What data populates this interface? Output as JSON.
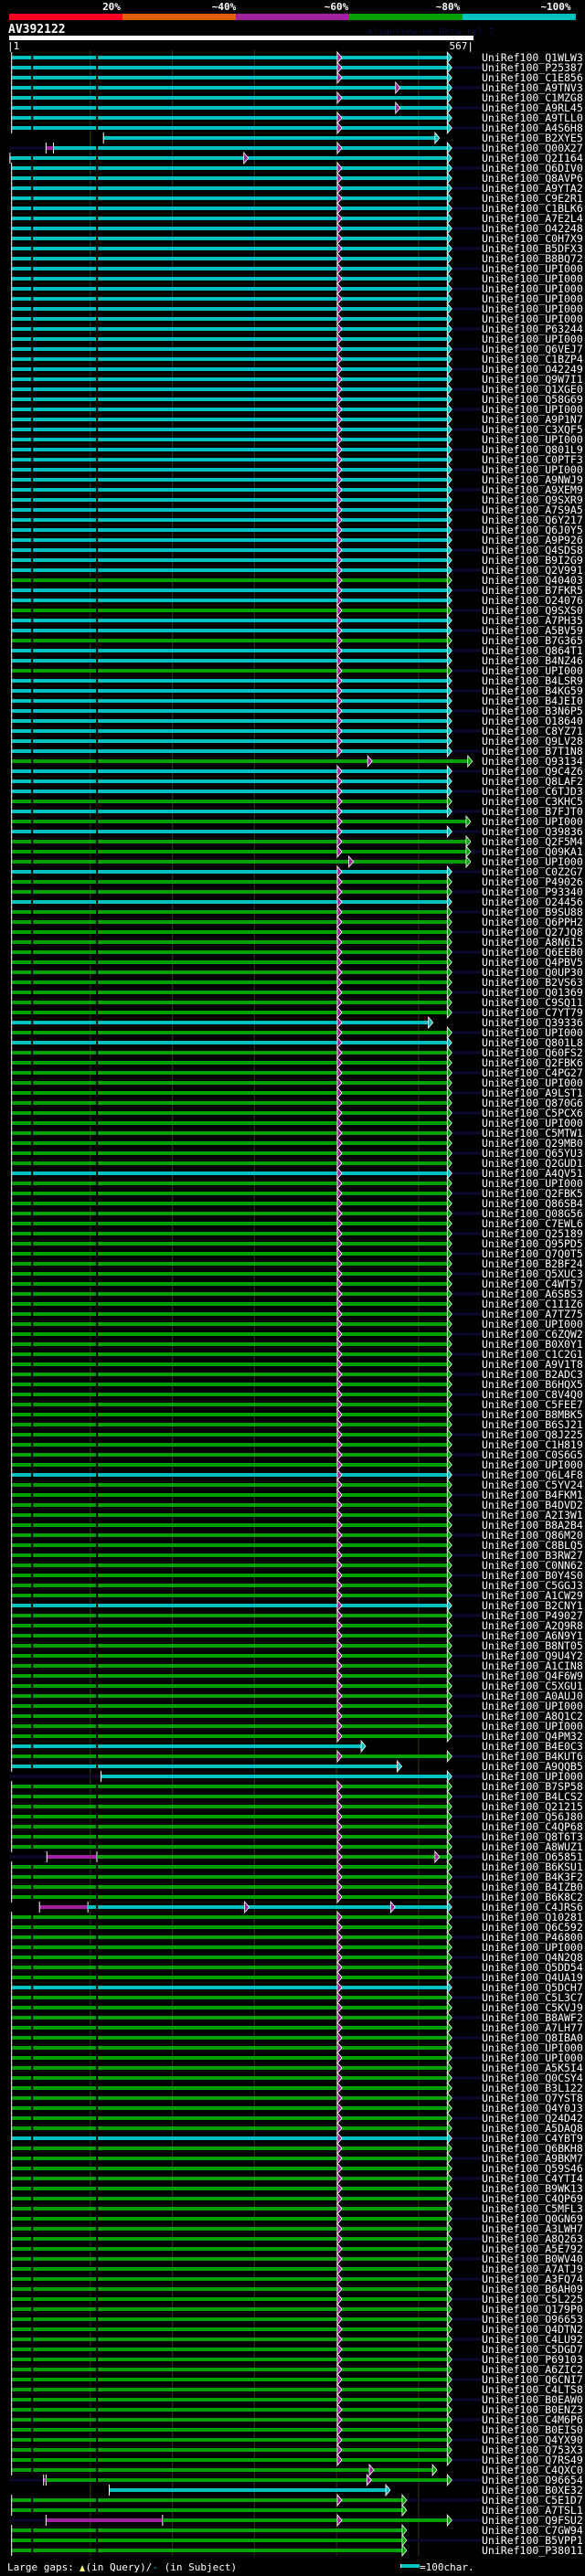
{
  "header": {
    "scale_labels": [
      "20%",
      "~40%",
      "~60%",
      "~80%",
      "~100%"
    ],
    "scale_colors": [
      "#ff0022",
      "#e06000",
      "#a020a0",
      "#00a000",
      "#00c0c0"
    ],
    "query_id": "AV392122",
    "watermark": "AlignView.pm Beta rel.7",
    "ruler_start": "|1",
    "ruler_end": "567|"
  },
  "query_length": 567,
  "colors": {
    "c": "#00c0c0",
    "g": "#00a000",
    "m": "#a020a0",
    "subject": "#0a0a30",
    "grid": "#3a3a10",
    "gap": "#ffff80"
  },
  "hits": {
    "defaults": {
      "start": 4,
      "end": 535,
      "marker": 401
    },
    "identity_runs": [
      [
        "c",
        52
      ],
      [
        "g",
        1
      ],
      [
        "c",
        2
      ],
      [
        "g",
        1
      ],
      [
        "c",
        2
      ],
      [
        "g",
        1
      ],
      [
        "c",
        2
      ],
      [
        "g",
        1
      ],
      [
        "c",
        8
      ],
      [
        "g",
        1
      ],
      [
        "c",
        3
      ],
      [
        "g",
        1
      ],
      [
        "c",
        1
      ],
      [
        "g",
        1
      ],
      [
        "c",
        1
      ],
      [
        "g",
        3
      ],
      [
        "c",
        1
      ],
      [
        "g",
        2
      ],
      [
        "c",
        1
      ],
      [
        "g",
        11
      ],
      [
        "c",
        1
      ],
      [
        "g",
        1
      ],
      [
        "c",
        1
      ],
      [
        "g",
        12
      ],
      [
        "c",
        1
      ],
      [
        "g",
        29
      ],
      [
        "c",
        1
      ],
      [
        "g",
        12
      ],
      [
        "c",
        1
      ],
      [
        "g",
        13
      ],
      [
        "c",
        1
      ],
      [
        "g",
        1
      ],
      [
        "c",
        2
      ],
      [
        "g",
        12
      ],
      [
        "c",
        1
      ],
      [
        "g",
        7
      ],
      [
        "c",
        1
      ],
      [
        "g",
        14
      ],
      [
        "c",
        1
      ],
      [
        "g",
        34
      ],
      [
        "c",
        1
      ],
      [
        "g",
        6
      ]
    ],
    "overrides": {
      "4": {
        "mk": 472
      },
      "6": {
        "mk": 472
      },
      "9": {
        "s": 116,
        "e": 520,
        "mk": 0
      },
      "10": {
        "s": 46,
        "pre": [
          46,
          55
        ]
      },
      "11": {
        "s": 2,
        "mk": 287
      },
      "71": {
        "e": 560,
        "mk": 438
      },
      "77": {
        "e": 558
      },
      "79": {
        "e": 558
      },
      "80": {
        "e": 558
      },
      "81": {
        "e": 558,
        "mk": 415
      },
      "97": {
        "e": 512
      },
      "169": {
        "e": 430,
        "mk": 0
      },
      "171": {
        "e": 474,
        "mk": 0
      },
      "172": {
        "s": 113,
        "mk": 0
      },
      "180": {
        "s": 47,
        "pre": [
          47,
          108
        ],
        "mk2": 520
      },
      "185": {
        "s": 38,
        "pre": [
          38,
          97
        ],
        "mk": 288,
        "mk2": 466
      },
      "241": {
        "e": 517,
        "mk": 440
      },
      "242": {
        "s": 43,
        "pre": [
          43,
          46
        ],
        "mk": 437
      },
      "243": {
        "s": 123,
        "e": 460,
        "mk": 0
      },
      "244": {
        "e": 480
      },
      "245": {
        "e": 480,
        "mk": 0
      },
      "246": {
        "s": 46,
        "pre": [
          46,
          188
        ]
      },
      "247": {
        "e": 480,
        "mk": 0
      },
      "248": {
        "e": 480,
        "mk": 0
      },
      "249": {
        "e": 480,
        "mk": 0
      }
    },
    "labels": [
      "UniRef100_Q1WLW3",
      "UniRef100_P25387",
      "UniRef100_C1E856",
      "UniRef100_A9TNV3",
      "UniRef100_C1MZG8",
      "UniRef100_A9RL45",
      "UniRef100_A9TLL0",
      "UniRef100_A4S6H8",
      "UniRef100_B2XYE5",
      "UniRef100_Q00X27",
      "UniRef100_Q2I164",
      "UniRef100_Q6DIV0",
      "UniRef100_Q8AVP6",
      "UniRef100_A9YTA2",
      "UniRef100_C9E2R1",
      "UniRef100_C1BLK6",
      "UniRef100_A7E2L4",
      "UniRef100_O42248",
      "UniRef100_C0H7X9",
      "UniRef100_B5DFX3",
      "UniRef100_B8BQ72",
      "UniRef100_UPI000..",
      "UniRef100_UPI000..",
      "UniRef100_UPI000..",
      "UniRef100_UPI000..",
      "UniRef100_UPI000..",
      "UniRef100_UPI000..",
      "UniRef100_P63244",
      "UniRef100_UPI000..",
      "UniRef100_Q6VEJ7",
      "UniRef100_C1BZP4",
      "UniRef100_O42249",
      "UniRef100_Q9W7I1",
      "UniRef100_Q1XGE0",
      "UniRef100_Q58G69",
      "UniRef100_UPI000..",
      "UniRef100_A9P1N7",
      "UniRef100_C3XQF5",
      "UniRef100_UPI000..",
      "UniRef100_Q801L9",
      "UniRef100_C0PTF3",
      "UniRef100_UPI000..",
      "UniRef100_A9NWJ9",
      "UniRef100_A9XEM9",
      "UniRef100_Q9SXR9",
      "UniRef100_A7S9A5",
      "UniRef100_Q6Y217",
      "UniRef100_Q6J0Y5",
      "UniRef100_A9P926",
      "UniRef100_Q4SDS8",
      "UniRef100_B9I2G9",
      "UniRef100_Q2V991",
      "UniRef100_Q40403",
      "UniRef100_B7FKR5",
      "UniRef100_O24076",
      "UniRef100_Q9SXS0",
      "UniRef100_A7PH35",
      "UniRef100_A5BV59",
      "UniRef100_B7G365",
      "UniRef100_Q864T1",
      "UniRef100_B4NZ46",
      "UniRef100_UPI000..",
      "UniRef100_B4LSR9",
      "UniRef100_B4KG59",
      "UniRef100_B4JEI0",
      "UniRef100_B3N6P5",
      "UniRef100_O18640",
      "UniRef100_C8YZ71",
      "UniRef100_Q9LV28",
      "UniRef100_B7T1N8",
      "UniRef100_Q93134",
      "UniRef100_Q9C4Z6",
      "UniRef100_Q8LAF2",
      "UniRef100_C6TJD3",
      "UniRef100_C3KHC5",
      "UniRef100_B7FJT0",
      "UniRef100_UPI000..",
      "UniRef100_Q39836",
      "UniRef100_Q2F5M4",
      "UniRef100_Q09KA1",
      "UniRef100_UPI000..",
      "UniRef100_C0Z2G7",
      "UniRef100_P49026",
      "UniRef100_P93340",
      "UniRef100_O24456",
      "UniRef100_B9SU88",
      "UniRef100_Q6PPH2",
      "UniRef100_Q27JQ8",
      "UniRef100_A8N6I5",
      "UniRef100_Q6EEB0",
      "UniRef100_Q4PBV5",
      "UniRef100_Q0UP30",
      "UniRef100_B2VS63",
      "UniRef100_Q01369",
      "UniRef100_C9SQ11",
      "UniRef100_C7YT79",
      "UniRef100_Q39336",
      "UniRef100_UPI000..",
      "UniRef100_Q801L8",
      "UniRef100_Q60FS2",
      "UniRef100_Q2FBK6",
      "UniRef100_C4PG27",
      "UniRef100_UPI000..",
      "UniRef100_A9LST1",
      "UniRef100_Q870G6",
      "UniRef100_C5PCX6",
      "UniRef100_UPI000..",
      "UniRef100_C5MTW1",
      "UniRef100_Q29MB0",
      "UniRef100_Q65YU3",
      "UniRef100_Q2GUD1",
      "UniRef100_A4QV51",
      "UniRef100_UPI000..",
      "UniRef100_Q2FBK5",
      "UniRef100_Q86SB4",
      "UniRef100_Q08G56",
      "UniRef100_C7EWL6",
      "UniRef100_Q25189",
      "UniRef100_Q95PD5",
      "UniRef100_Q7Q0T5",
      "UniRef100_B2BF24",
      "UniRef100_Q5XUC3",
      "UniRef100_C4WT57",
      "UniRef100_A6SBS3",
      "UniRef100_C1I1Z6",
      "UniRef100_A7TZ75",
      "UniRef100_UPI000..",
      "UniRef100_C6ZQW2",
      "UniRef100_B0X0Y1",
      "UniRef100_C1C2G1",
      "UniRef100_A9V1T8",
      "UniRef100_B2ADC3",
      "UniRef100_B6HQX5",
      "UniRef100_C8V4Q0",
      "UniRef100_C5FEE7",
      "UniRef100_B8MBK5",
      "UniRef100_B6SJ21",
      "UniRef100_Q8J225",
      "UniRef100_C1H819",
      "UniRef100_C0S6G5",
      "UniRef100_UPI000..",
      "UniRef100_Q6L4F8",
      "UniRef100_C5YV24",
      "UniRef100_B4FKM1",
      "UniRef100_B4DVD2",
      "UniRef100_A2I3W1",
      "UniRef100_B8A2B4",
      "UniRef100_Q86M20",
      "UniRef100_C8BLQ5",
      "UniRef100_B3RW27",
      "UniRef100_C0NN62",
      "UniRef100_B0Y4S0",
      "UniRef100_C5GGJ3",
      "UniRef100_A1CW29",
      "UniRef100_B2CNY1",
      "UniRef100_P49027",
      "UniRef100_A2Q9R8",
      "UniRef100_A6N9Y1",
      "UniRef100_B8NT05",
      "UniRef100_Q9U4Y2",
      "UniRef100_A1CIN8",
      "UniRef100_Q4F6W9",
      "UniRef100_C5XGU1",
      "UniRef100_A0AUJ0",
      "UniRef100_UPI000..",
      "UniRef100_A8Q1C2",
      "UniRef100_UPI000..",
      "UniRef100_Q4PM32",
      "UniRef100_B4E0C3",
      "UniRef100_B4KUT6",
      "UniRef100_A9QQB5",
      "UniRef100_UPI000..",
      "UniRef100_B7SP58",
      "UniRef100_B4LCS2",
      "UniRef100_Q21215",
      "UniRef100_Q56J80",
      "UniRef100_C4QP68",
      "UniRef100_Q8T6T3",
      "UniRef100_A8WUZ1",
      "UniRef100_O65851",
      "UniRef100_B6KSU1",
      "UniRef100_B4K3F2",
      "UniRef100_B4IZB0",
      "UniRef100_B6K8C2",
      "UniRef100_C4JRS6",
      "UniRef100_Q10281",
      "UniRef100_Q6C592",
      "UniRef100_P46800",
      "UniRef100_UPI000..",
      "UniRef100_Q4N2Q8",
      "UniRef100_Q5DD54",
      "UniRef100_Q4UA19",
      "UniRef100_Q5DCH7",
      "UniRef100_C5L3C7",
      "UniRef100_C5KVJ9",
      "UniRef100_B8AWF2",
      "UniRef100_A7LH77",
      "UniRef100_Q8IBA0",
      "UniRef100_UPI000..",
      "UniRef100_UPI000..",
      "UniRef100_A5K5I4",
      "UniRef100_Q0CSY4",
      "UniRef100_B3L122",
      "UniRef100_Q7YST8",
      "UniRef100_Q4Y0J3",
      "UniRef100_Q24D42",
      "UniRef100_A5DAQ8",
      "UniRef100_C4YBT9",
      "UniRef100_Q6BKH8",
      "UniRef100_A9BKM7",
      "UniRef100_Q59S46",
      "UniRef100_C4YTI4",
      "UniRef100_B9WK13",
      "UniRef100_C4QP69",
      "UniRef100_C5MFL3",
      "UniRef100_Q0GN69",
      "UniRef100_A3LWH7",
      "UniRef100_A8Q263",
      "UniRef100_A5E792",
      "UniRef100_B0WV40",
      "UniRef100_A7ATJ9",
      "UniRef100_A3FQ74",
      "UniRef100_B6AH09",
      "UniRef100_C5L225",
      "UniRef100_Q179P0",
      "UniRef100_O96653",
      "UniRef100_Q4DTN2",
      "UniRef100_C4LU92",
      "UniRef100_C5DGD7",
      "UniRef100_P69103",
      "UniRef100_A6ZIC2",
      "UniRef100_Q6CNI7",
      "UniRef100_C4LTS8",
      "UniRef100_B0EAW0",
      "UniRef100_B0ENZ3",
      "UniRef100_C4M6P6",
      "UniRef100_B0EIS0",
      "UniRef100_Q4YX90",
      "UniRef100_Q753X3",
      "UniRef100_Q7RS49",
      "UniRef100_C4QXC0",
      "UniRef100_O96654",
      "UniRef100_B0XE32",
      "UniRef100_C5E1D7",
      "UniRef100_A7TSL1",
      "UniRef100_Q9FSU2",
      "UniRef100_C7GW94",
      "UniRef100_B5VPP1",
      "UniRef100_P38011"
    ]
  },
  "legend": {
    "gaps_label": "Large gaps:",
    "query_label": "(in Query)/",
    "subject_dash": "-",
    "subject_label": " (in Subject)",
    "scale_label": "=100char."
  }
}
